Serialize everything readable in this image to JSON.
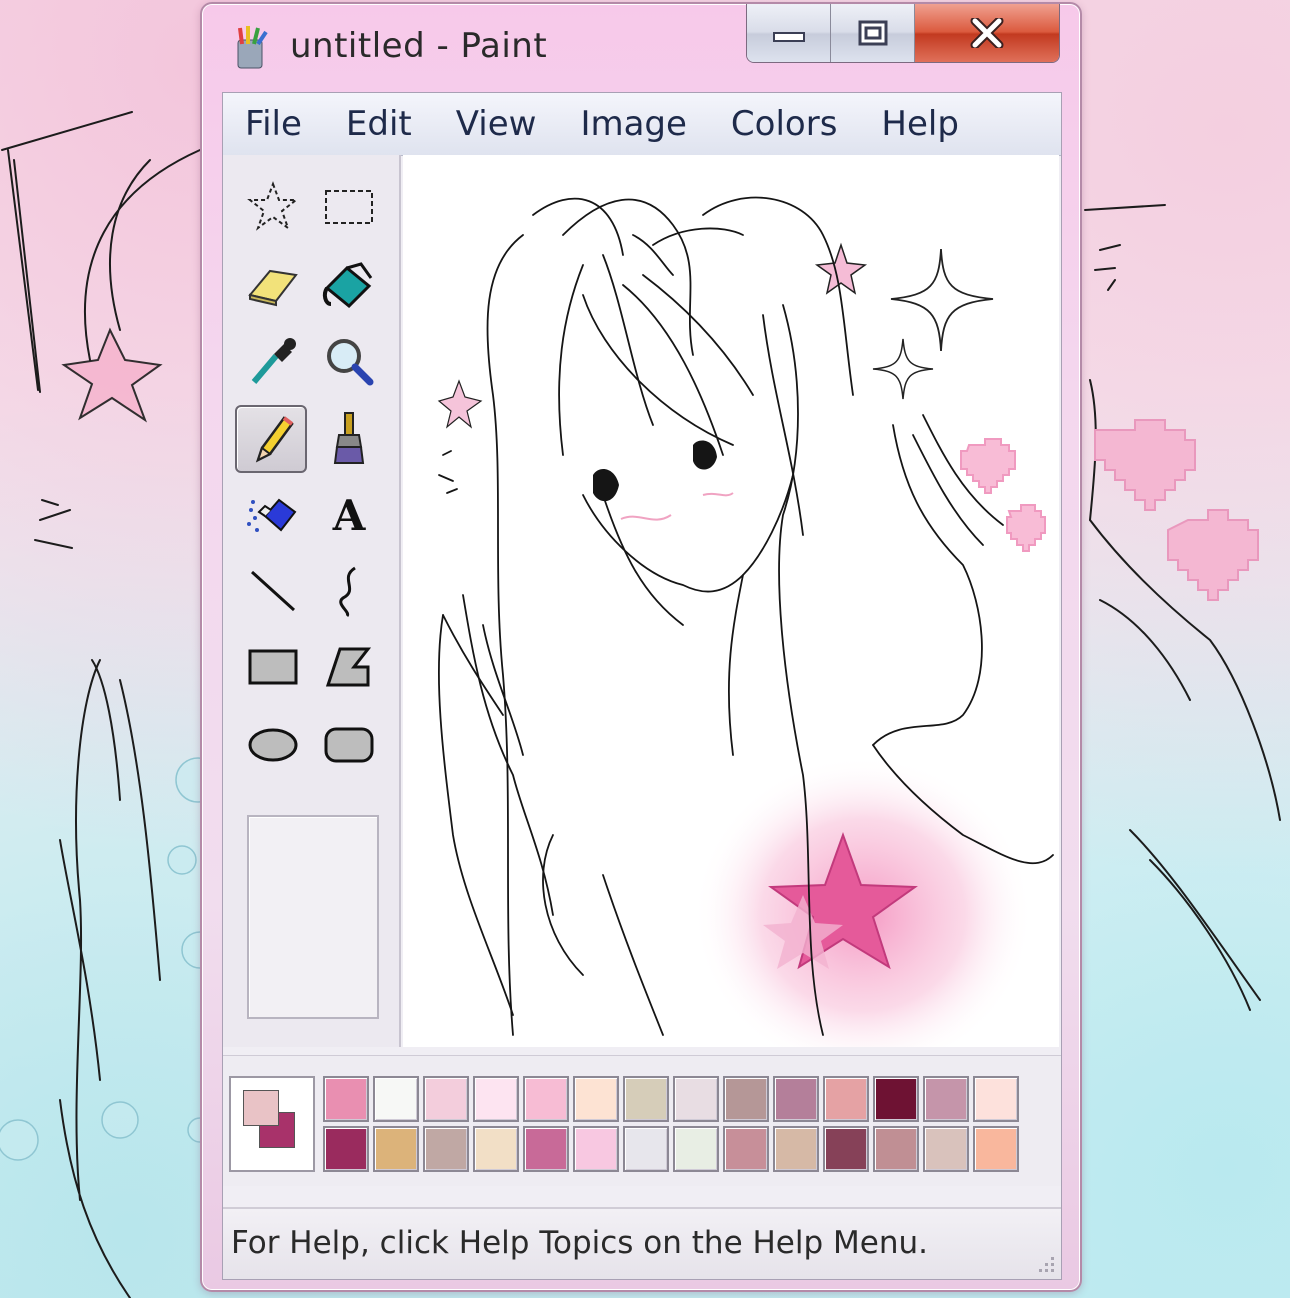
{
  "window": {
    "title": "untitled - Paint"
  },
  "menu": [
    "File",
    "Edit",
    "View",
    "Image",
    "Colors",
    "Help"
  ],
  "tools": [
    {
      "name": "free-form-select",
      "icon": "star-select-icon"
    },
    {
      "name": "rectangle-select",
      "icon": "rect-select-icon"
    },
    {
      "name": "eraser",
      "icon": "eraser-icon"
    },
    {
      "name": "fill-with-color",
      "icon": "paint-bucket-icon"
    },
    {
      "name": "pick-color",
      "icon": "eyedropper-icon"
    },
    {
      "name": "magnifier",
      "icon": "magnifier-icon"
    },
    {
      "name": "pencil",
      "icon": "pencil-icon",
      "selected": true
    },
    {
      "name": "brush",
      "icon": "brush-icon"
    },
    {
      "name": "airbrush",
      "icon": "airbrush-icon"
    },
    {
      "name": "text",
      "icon": "text-icon",
      "glyph": "A"
    },
    {
      "name": "line",
      "icon": "line-icon"
    },
    {
      "name": "curve",
      "icon": "curve-icon"
    },
    {
      "name": "rectangle",
      "icon": "rectangle-icon"
    },
    {
      "name": "polygon",
      "icon": "polygon-icon"
    },
    {
      "name": "ellipse",
      "icon": "ellipse-icon"
    },
    {
      "name": "rounded-rectangle",
      "icon": "rounded-rect-icon"
    }
  ],
  "colors": {
    "foreground": "#e9c3c6",
    "background": "#a8326a",
    "palette_row1": [
      "#e98fb1",
      "#f7f8f6",
      "#f3cddc",
      "#fde4f1",
      "#f7bcd4",
      "#fde3d3",
      "#d6cdb9",
      "#e8dde3",
      "#b59797",
      "#b47f9a",
      "#e5a2a4",
      "#6e1233",
      "#c595aa",
      "#fde1dc"
    ],
    "palette_row2": [
      "#9a2b5e",
      "#dcb37a",
      "#c0a8a4",
      "#f2dfc6",
      "#c86a98",
      "#f8c8e1",
      "#e7e6ec",
      "#e8eee4",
      "#c78f99",
      "#d6b9a6",
      "#864158",
      "#c08f94",
      "#d9c2bc",
      "#f9b79d"
    ]
  },
  "status": {
    "text": "For Help, click Help Topics on the Help Menu."
  }
}
